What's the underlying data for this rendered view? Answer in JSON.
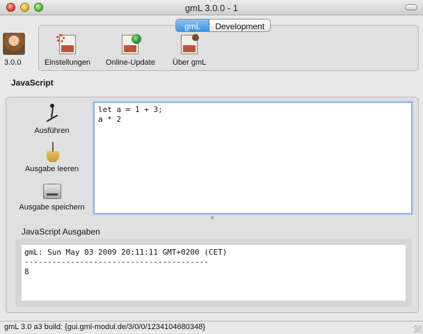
{
  "window": {
    "title": "gmL 3.0.0 - 1"
  },
  "version": "3.0.0",
  "tabs": [
    {
      "label": "gmL",
      "active": true
    },
    {
      "label": "Development",
      "active": false
    }
  ],
  "toolbar": {
    "items": [
      {
        "label": "Einstellungen",
        "icon": "settings-icon"
      },
      {
        "label": "Online-Update",
        "icon": "update-icon"
      },
      {
        "label": "Über gmL",
        "icon": "about-icon"
      }
    ]
  },
  "section": {
    "title": "JavaScript"
  },
  "actions": [
    {
      "label": "Ausführen",
      "icon": "run-icon"
    },
    {
      "label": "Ausgabe leeren",
      "icon": "broom-icon"
    },
    {
      "label": "Ausgabe speichern",
      "icon": "save-drive-icon"
    }
  ],
  "editor": {
    "code": "let a = 1 + 3;\na * 2"
  },
  "output": {
    "title": "JavaScript Ausgaben",
    "text": "gmL: Sun May 03 2009 20:11:11 GMT+0200 (CET)\n----------------------------------------\n8"
  },
  "status": {
    "text": "gmL 3.0 a3 build: {gui.gml-modul.de/3/0/0/1234104680348}"
  },
  "colors": {
    "accent": "#3c8ee6",
    "editor_focus": "#7aa7e0"
  }
}
